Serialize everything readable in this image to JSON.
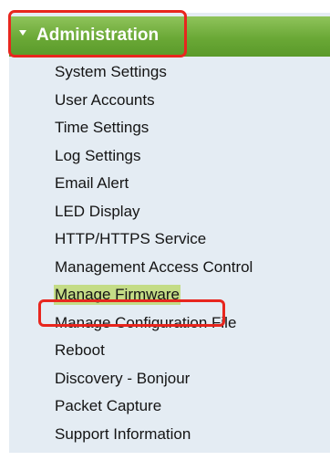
{
  "nav": {
    "header": {
      "label": "Administration",
      "expanded": true
    },
    "items": [
      {
        "label": "System Settings",
        "selected": false
      },
      {
        "label": "User Accounts",
        "selected": false
      },
      {
        "label": "Time Settings",
        "selected": false
      },
      {
        "label": "Log Settings",
        "selected": false
      },
      {
        "label": "Email Alert",
        "selected": false
      },
      {
        "label": "LED Display",
        "selected": false
      },
      {
        "label": "HTTP/HTTPS Service",
        "selected": false
      },
      {
        "label": "Management Access Control",
        "selected": false
      },
      {
        "label": "Manage Firmware",
        "selected": true
      },
      {
        "label": "Manage Configuration File",
        "selected": false
      },
      {
        "label": "Reboot",
        "selected": false
      },
      {
        "label": "Discovery - Bonjour",
        "selected": false
      },
      {
        "label": "Packet Capture",
        "selected": false
      },
      {
        "label": "Support Information",
        "selected": false
      }
    ]
  },
  "colors": {
    "header_green": "#6aa836",
    "panel_background": "#e4ecf3",
    "highlight_red": "#e8261e",
    "selected_background": "#c4dc86"
  }
}
